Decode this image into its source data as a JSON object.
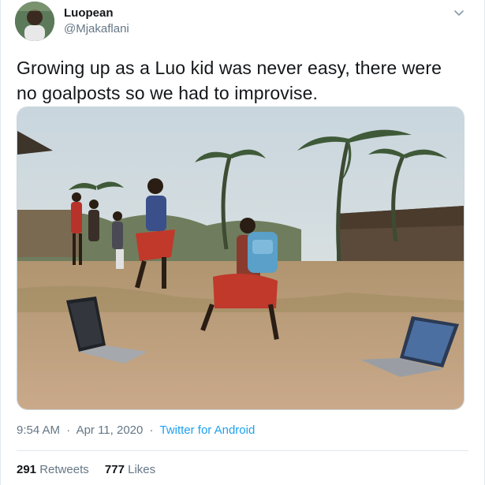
{
  "author": {
    "name": "Luopean",
    "handle": "@Mjakaflani"
  },
  "tweet": {
    "text": "Growing up as a Luo kid was never easy, there were no goalposts so we had to improvise.",
    "time": "9:54 AM",
    "separator": "·",
    "date": "Apr 11, 2020",
    "source": "Twitter for Android"
  },
  "stats": {
    "retweets_count": "291",
    "retweets_label": "Retweets",
    "likes_count": "777",
    "likes_label": "Likes"
  },
  "icons": {
    "menu": "chevron-down-icon"
  },
  "colors": {
    "link": "#1da1f2",
    "secondary_text": "#657786",
    "border": "#e1e8ed"
  }
}
